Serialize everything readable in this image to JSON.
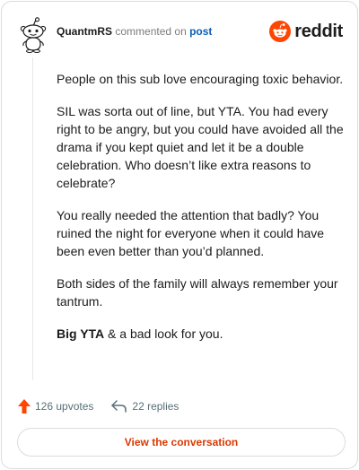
{
  "header": {
    "author": "QuantmRS",
    "action_text": "commented on",
    "post_link": "post",
    "brand": "reddit",
    "brand_color": "#ff4500"
  },
  "comment": {
    "paragraphs": [
      "People on this sub love encouraging toxic behavior.",
      "SIL was sorta out of line, but YTA. You had every right to be angry, but you could have avoided all the drama if you kept quiet and let it be a double celebration. Who doesn’t like extra reasons to celebrate?",
      "You really needed the attention that badly? You ruined the night for everyone when it could have been even better than you’d planned.",
      "Both sides of the family will always remember your tantrum."
    ],
    "last_strong": "Big YTA",
    "last_rest": " & a bad look for you."
  },
  "footer": {
    "upvotes": "126 upvotes",
    "replies": "22 replies",
    "upvote_icon": "upvote-arrow-icon",
    "reply_icon": "reply-arrow-icon",
    "upvote_color": "#ff4500"
  },
  "cta": {
    "label": "View the conversation",
    "color": "#d93900"
  }
}
